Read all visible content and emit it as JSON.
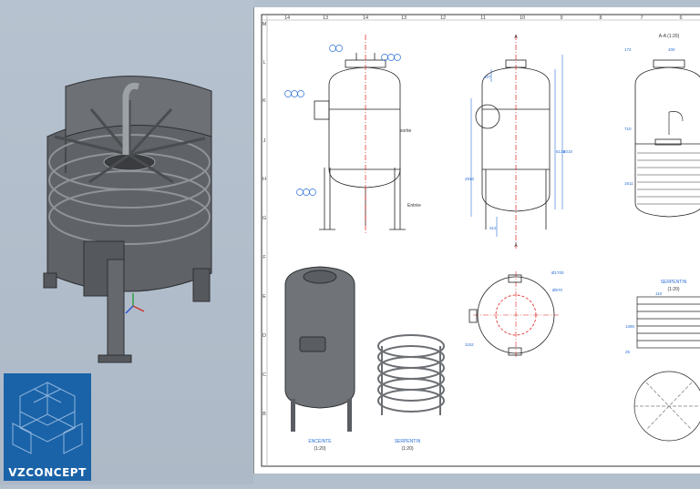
{
  "brand": {
    "name": "VZCONCEPT"
  },
  "sheet": {
    "column_labels": [
      "14",
      "13",
      "14",
      "13",
      "12",
      "11",
      "10",
      "9",
      "8",
      "7",
      "6"
    ],
    "row_labels": [
      "M",
      "L",
      "K",
      "J",
      "H",
      "G",
      "F",
      "E",
      "D",
      "C",
      "B"
    ],
    "views": {
      "section_aa": "A-A (1:20)",
      "section_marker": "A",
      "enceinte_title": "ENCEINTE",
      "enceinte_scale": "(1:20)",
      "serpentin_title": "SERPENTIN",
      "serpentin_scale": "(1:20)",
      "serpentin_detail_title": "SERPENTIN",
      "serpentin_detail_scale": "(1:20)"
    },
    "annotations": {
      "sortie": "sortie",
      "entree": "Entrée",
      "dia_top": "Ø1700",
      "dia_inner": "Ø670"
    },
    "dimensions": [
      "172",
      "400",
      "407",
      "6135",
      "4010",
      "2910",
      "312",
      "1152",
      "110",
      "1390",
      "25",
      "710",
      "1611"
    ]
  },
  "colors": {
    "background": "#b3bfcc",
    "sheet": "#ffffff",
    "dimension": "#2b6fd6",
    "centerline": "#e02020",
    "logo": "#1a63a8"
  },
  "icons": [
    "tank-3d-model-icon",
    "axis-triad-icon",
    "cube-logo-icon"
  ]
}
